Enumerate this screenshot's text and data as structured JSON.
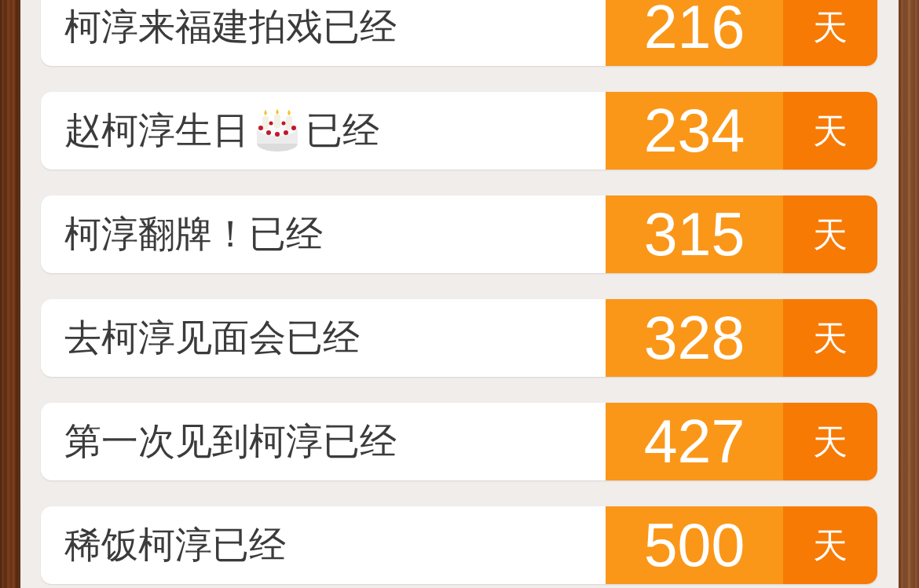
{
  "events": [
    {
      "kind": "text",
      "label": "柯淳来福建拍戏已经",
      "count": "216",
      "unit": "天"
    },
    {
      "kind": "with-icon",
      "label": "赵柯淳生日",
      "label_after": "已经",
      "count": "234",
      "unit": "天"
    },
    {
      "kind": "text",
      "label": "柯淳翻牌！已经",
      "count": "315",
      "unit": "天"
    },
    {
      "kind": "text",
      "label": "去柯淳见面会已经",
      "count": "328",
      "unit": "天"
    },
    {
      "kind": "text",
      "label": "第一次见到柯淳已经",
      "count": "427",
      "unit": "天"
    },
    {
      "kind": "text",
      "label": "稀饭柯淳已经",
      "count": "500",
      "unit": "天"
    }
  ]
}
